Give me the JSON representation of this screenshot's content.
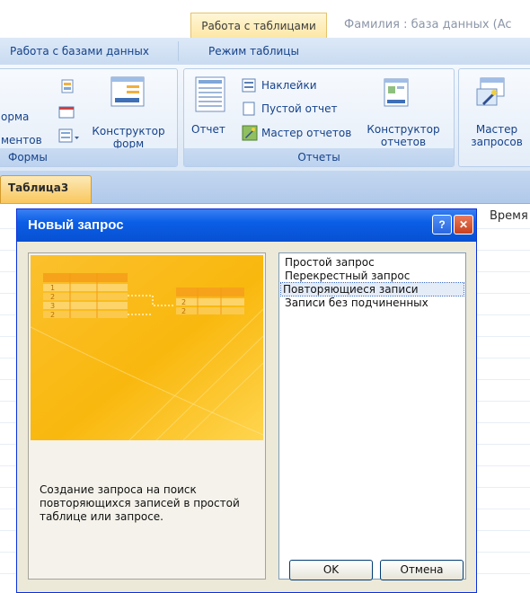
{
  "context_tab": {
    "label": "Работа с таблицами"
  },
  "window": {
    "title": "Фамилия : база данных (Ac"
  },
  "ribbon_tabs": [
    "Работа с базами данных",
    "Режим таблицы"
  ],
  "ribbon": {
    "forms_group": {
      "caption": "Формы",
      "form_label": "орма",
      "documents_label": "ментов",
      "form_designer": [
        "Конструктор",
        "форм"
      ]
    },
    "reports_group": {
      "caption": "Отчеты",
      "report": "Отчет",
      "labels": "Наклейки",
      "blank_report": "Пустой отчет",
      "report_wizard": "Мастер отчетов",
      "report_designer": [
        "Конструктор",
        "отчетов"
      ]
    },
    "queries_group": {
      "query_wizard": [
        "Мастер",
        "запросов"
      ]
    }
  },
  "document": {
    "tab": "Таблица3",
    "column_header": "Время"
  },
  "dialog": {
    "title": "Новый запрос",
    "help_button": "?",
    "close_button": "✕",
    "description": "Создание запроса на поиск повторяющихся записей в простой таблице или запросе.",
    "preview_numbers": [
      "1",
      "2",
      "3",
      "2",
      "2",
      "2"
    ],
    "list_items": [
      {
        "label": "Простой запрос",
        "selected": false
      },
      {
        "label": "Перекрестный запрос",
        "selected": false
      },
      {
        "label": "Повторяющиеся записи",
        "selected": true
      },
      {
        "label": "Записи без подчиненных",
        "selected": false
      }
    ],
    "ok_button": "OK",
    "cancel_button": "Отмена"
  },
  "colors": {
    "titlebar": "#0a5ee6",
    "selection": "#e4ecf8",
    "preview_orange": "#f9b80e",
    "ribbon_text": "#15428b"
  }
}
